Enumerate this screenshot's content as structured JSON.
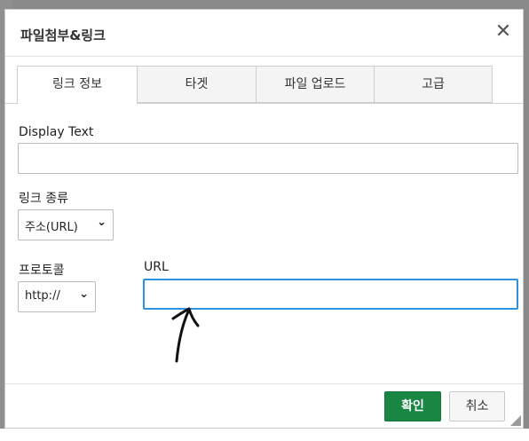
{
  "dialog": {
    "title": "파일첨부&링크",
    "close_icon": "close-icon"
  },
  "tabs": [
    {
      "label": "링크 정보",
      "active": true
    },
    {
      "label": "타겟",
      "active": false
    },
    {
      "label": "파일 업로드",
      "active": false
    },
    {
      "label": "고급",
      "active": false
    }
  ],
  "form": {
    "display_text": {
      "label": "Display Text",
      "value": ""
    },
    "link_type": {
      "label": "링크 종류",
      "selected": "주소(URL)"
    },
    "protocol": {
      "label": "프로토콜",
      "selected": "http://"
    },
    "url": {
      "label": "URL",
      "value": ""
    }
  },
  "footer": {
    "ok_label": "확인",
    "cancel_label": "취소"
  },
  "colors": {
    "ok_button": "#1a8644",
    "focus_border": "#2f92e0"
  }
}
